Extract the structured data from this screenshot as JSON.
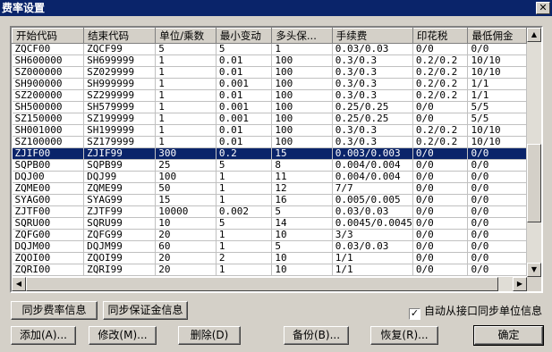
{
  "window": {
    "title": "费率设置",
    "close_glyph": "✕"
  },
  "grid": {
    "columns": [
      "开始代码",
      "结束代码",
      "单位/乘数",
      "最小变动",
      "多头保...",
      "手续费",
      "印花税",
      "最低佣金"
    ],
    "rows": [
      [
        "ZQCF00",
        "ZQCF99",
        "5",
        "5",
        "1",
        "0.03/0.03",
        "0/0",
        "0/0"
      ],
      [
        "SH600000",
        "SH699999",
        "1",
        "0.01",
        "100",
        "0.3/0.3",
        "0.2/0.2",
        "10/10"
      ],
      [
        "SZ000000",
        "SZ029999",
        "1",
        "0.01",
        "100",
        "0.3/0.3",
        "0.2/0.2",
        "10/10"
      ],
      [
        "SH900000",
        "SH999999",
        "1",
        "0.001",
        "100",
        "0.3/0.3",
        "0.2/0.2",
        "1/1"
      ],
      [
        "SZ200000",
        "SZ299999",
        "1",
        "0.01",
        "100",
        "0.3/0.3",
        "0.2/0.2",
        "1/1"
      ],
      [
        "SH500000",
        "SH579999",
        "1",
        "0.001",
        "100",
        "0.25/0.25",
        "0/0",
        "5/5"
      ],
      [
        "SZ150000",
        "SZ199999",
        "1",
        "0.001",
        "100",
        "0.25/0.25",
        "0/0",
        "5/5"
      ],
      [
        "SH001000",
        "SH199999",
        "1",
        "0.01",
        "100",
        "0.3/0.3",
        "0.2/0.2",
        "10/10"
      ],
      [
        "SZ100000",
        "SZ179999",
        "1",
        "0.01",
        "100",
        "0.3/0.3",
        "0.2/0.2",
        "10/10"
      ],
      [
        "ZJIF00",
        "ZJIF99",
        "300",
        "0.2",
        "15",
        "0.003/0.003",
        "0/0",
        "0/0"
      ],
      [
        "SQPB00",
        "SQPB99",
        "25",
        "5",
        "8",
        "0.004/0.004",
        "0/0",
        "0/0"
      ],
      [
        "DQJ00",
        "DQJ99",
        "100",
        "1",
        "11",
        "0.004/0.004",
        "0/0",
        "0/0"
      ],
      [
        "ZQME00",
        "ZQME99",
        "50",
        "1",
        "12",
        "7/7",
        "0/0",
        "0/0"
      ],
      [
        "SYAG00",
        "SYAG99",
        "15",
        "1",
        "16",
        "0.005/0.005",
        "0/0",
        "0/0"
      ],
      [
        "ZJTF00",
        "ZJTF99",
        "10000",
        "0.002",
        "5",
        "0.03/0.03",
        "0/0",
        "0/0"
      ],
      [
        "SQRU00",
        "SQRU99",
        "10",
        "5",
        "14",
        "0.0045/0.0045",
        "0/0",
        "0/0"
      ],
      [
        "ZQFG00",
        "ZQFG99",
        "20",
        "1",
        "10",
        "3/3",
        "0/0",
        "0/0"
      ],
      [
        "DQJM00",
        "DQJM99",
        "60",
        "1",
        "5",
        "0.03/0.03",
        "0/0",
        "0/0"
      ],
      [
        "ZQOI00",
        "ZQOI99",
        "20",
        "2",
        "10",
        "1/1",
        "0/0",
        "0/0"
      ],
      [
        "ZQRI00",
        "ZQRI99",
        "20",
        "1",
        "10",
        "1/1",
        "0/0",
        "0/0"
      ]
    ],
    "selected_row": 9
  },
  "scrollbars": {
    "up": "▲",
    "down": "▼",
    "left": "◀",
    "right": "▶"
  },
  "actions": {
    "sync_rate": "同步费率信息",
    "sync_margin": "同步保证金信息",
    "sync_unit_checkbox_label": "自动从接口同步单位信息",
    "sync_unit_checked": "✓",
    "add": "添加(A)...",
    "modify": "修改(M)...",
    "delete": "删除(D)",
    "backup": "备份(B)...",
    "restore": "恢复(R)...",
    "ok": "确定"
  }
}
